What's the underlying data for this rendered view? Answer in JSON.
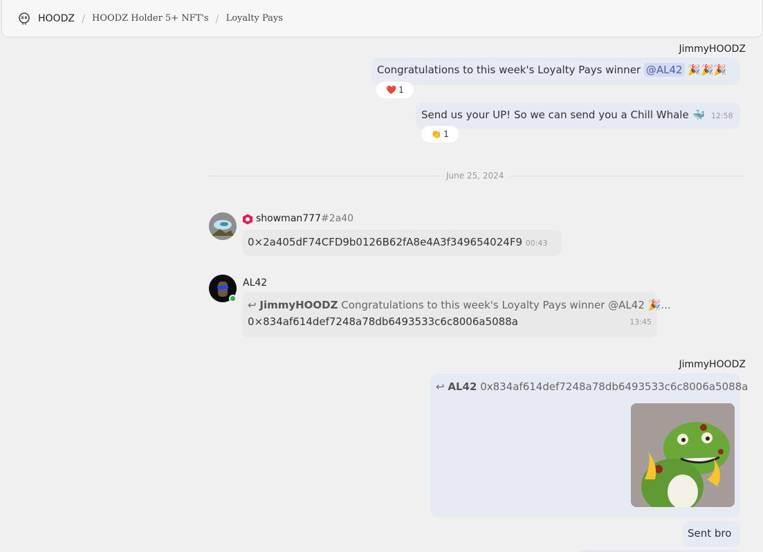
{
  "breadcrumb": {
    "workspace": "HOODZ",
    "channel_group": "HOODZ Holder 5+ NFT's",
    "channel": "Loyalty Pays",
    "separator": "/"
  },
  "messages": {
    "m1": {
      "sender": "JimmyHOODZ",
      "text": "Congratulations to this week's Loyalty Pays winner",
      "mention": "@AL42",
      "emoji": "🎉🎉🎉",
      "reaction": {
        "emoji": "❤️",
        "count": "1"
      }
    },
    "m2": {
      "text": "Send us your UP! So we can send you a Chill Whale",
      "emoji": "🐳",
      "time": "12:58",
      "reaction": {
        "emoji": "👏",
        "count": "1"
      }
    },
    "date_divider": "June 25, 2024",
    "m3": {
      "sender_name": "showman777",
      "sender_tag": "#2a40",
      "text": "0×2a405dF74CFD9b0126B62fA8e4A3f349654024F9",
      "time": "00:43"
    },
    "m4": {
      "sender": "AL42",
      "reply_to": "JimmyHOODZ",
      "reply_text": "Congratulations to this week's Loyalty Pays winner @AL42 🎉...",
      "text": "0×834af614def7248a78db6493533c6c8006a5088a",
      "time": "13:45"
    },
    "m5": {
      "sender": "JimmyHOODZ",
      "reply_to": "AL42",
      "reply_text": "0x834af614def7248a78db6493533c6c8006a5088a",
      "image_icon": "nft-frog-image"
    },
    "m6": {
      "text": "Sent bro"
    }
  },
  "colors": {
    "background": "#f0f0f0",
    "own_bubble": "#e6eaf2",
    "other_bubble": "#e9e9e9",
    "mention": "#4a5bb0",
    "online": "#2bb04b",
    "badge": "#e8195a"
  }
}
